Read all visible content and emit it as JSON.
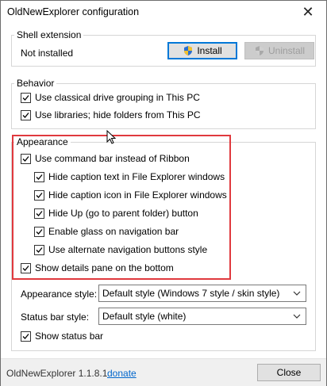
{
  "window": {
    "title": "OldNewExplorer configuration"
  },
  "shell_extension": {
    "label": "Shell extension",
    "status": "Not installed",
    "install_label": "Install",
    "uninstall_label": "Uninstall"
  },
  "behavior": {
    "label": "Behavior",
    "items": [
      {
        "label": "Use classical drive grouping in This PC",
        "checked": true
      },
      {
        "label": "Use libraries; hide folders from This PC",
        "checked": true
      }
    ]
  },
  "appearance": {
    "label": "Appearance",
    "command_bar": {
      "label": "Use command bar instead of Ribbon",
      "checked": true
    },
    "sub_items": [
      {
        "label": "Hide caption text in File Explorer windows",
        "checked": true
      },
      {
        "label": "Hide caption icon in File Explorer windows",
        "checked": true
      },
      {
        "label": "Hide Up (go to parent folder) button",
        "checked": true
      },
      {
        "label": "Enable glass on navigation bar",
        "checked": true
      },
      {
        "label": "Use alternate navigation buttons style",
        "checked": true
      }
    ],
    "details_pane": {
      "label": "Show details pane on the bottom",
      "checked": true
    },
    "appearance_style": {
      "label": "Appearance style:",
      "value": "Default style (Windows 7 style / skin style)"
    },
    "status_bar_style": {
      "label": "Status bar style:",
      "value": "Default style (white)"
    },
    "show_status_bar": {
      "label": "Show status bar",
      "checked": true
    }
  },
  "footer": {
    "version": "OldNewExplorer 1.1.8.1",
    "donate": "donate",
    "close_label": "Close"
  },
  "colors": {
    "highlight": "#e0393e",
    "link": "#0066cc",
    "accent": "#0078d7"
  }
}
